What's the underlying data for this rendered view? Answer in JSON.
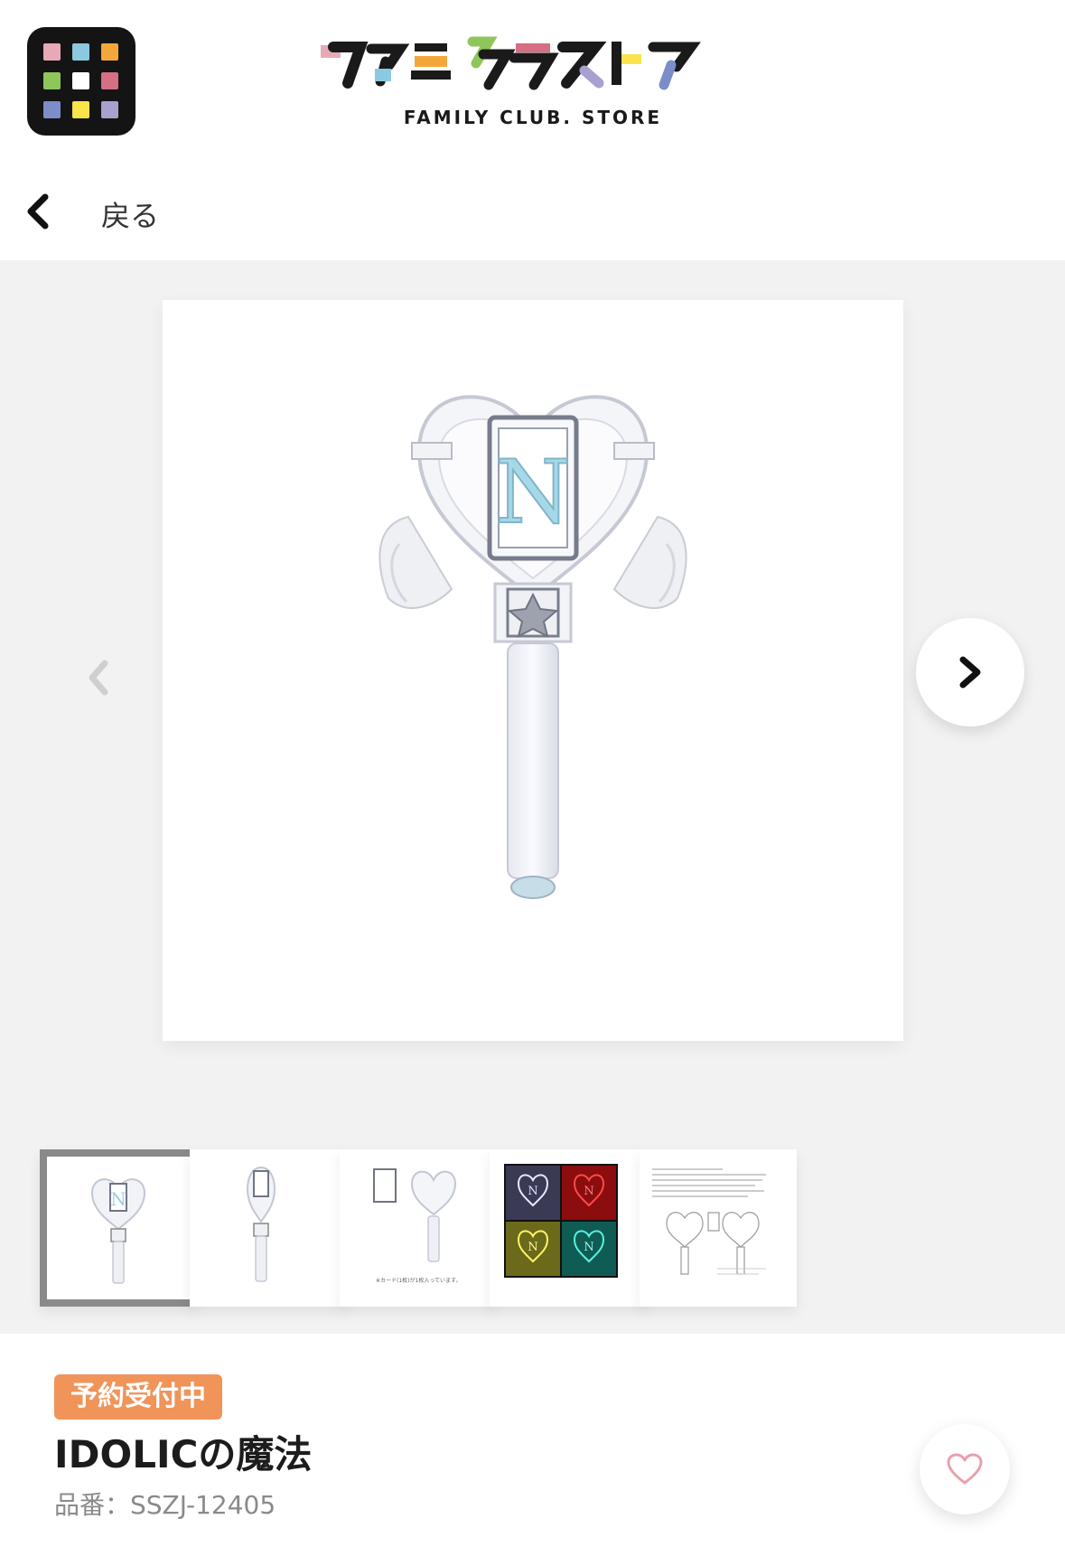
{
  "header": {
    "app_icon": "grid-app-icon",
    "logo_text": "ファミクラストア",
    "logo_sub": "FAMILY CLUB. STORE",
    "logo_colors": [
      "#e8a9b7",
      "#8cc8e0",
      "#f3a73b",
      "#8fc65a",
      "#d46f84",
      "#fbe34b",
      "#a8a0cf",
      "#7c8ec9"
    ]
  },
  "nav": {
    "back_label": "戻る",
    "back_icon": "chevron-left-icon"
  },
  "gallery": {
    "main_image": "heart-wing-penlight-image",
    "prev_icon": "chevron-left-icon",
    "next_icon": "chevron-right-icon",
    "active_index": 0,
    "thumbnails": [
      {
        "name": "penlight-front"
      },
      {
        "name": "penlight-side"
      },
      {
        "name": "penlight-card-insert",
        "caption": "※カード(1枚)が1枚入っています。"
      },
      {
        "name": "penlight-colors",
        "colors": [
          "#7a7a9c",
          "#e01616",
          "#e8e04a",
          "#1fb3a3"
        ]
      },
      {
        "name": "penlight-instructions"
      }
    ]
  },
  "product": {
    "status_badge": "予約受付中",
    "status_color": "#f0945a",
    "title": "IDOLICの魔法",
    "sku": "品番：SSZJ-12405",
    "favorite_icon": "heart-outline-icon"
  }
}
